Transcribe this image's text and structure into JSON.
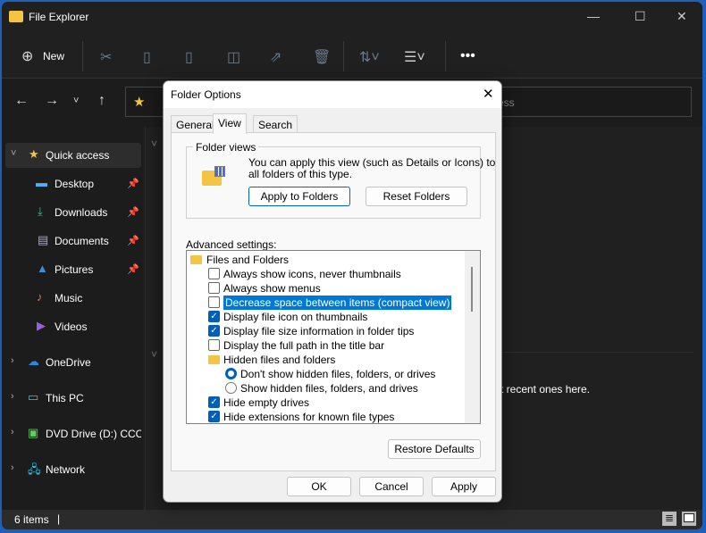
{
  "window": {
    "title": "File Explorer",
    "controls": [
      "minimize",
      "maximize",
      "close"
    ]
  },
  "toolbar": {
    "new_label": "New",
    "icons": [
      "cut-icon",
      "copy-icon",
      "paste-icon",
      "rename-icon",
      "share-icon",
      "delete-icon",
      "sort-icon",
      "view-icon",
      "more-icon"
    ]
  },
  "address": {
    "search_fragment": "ess"
  },
  "sidebar": {
    "quick_access": "Quick access",
    "pinned": [
      {
        "label": "Desktop"
      },
      {
        "label": "Downloads"
      },
      {
        "label": "Documents"
      },
      {
        "label": "Pictures"
      },
      {
        "label": "Music"
      },
      {
        "label": "Videos"
      }
    ],
    "roots": [
      {
        "label": "OneDrive"
      },
      {
        "label": "This PC"
      },
      {
        "label": "DVD Drive (D:) CCCC"
      },
      {
        "label": "Network"
      }
    ]
  },
  "content": {
    "fragment": "t recent ones here."
  },
  "status": {
    "items": "6 items"
  },
  "dialog": {
    "title": "Folder Options",
    "tabs": [
      "General",
      "View",
      "Search"
    ],
    "active_tab": "View",
    "folder_views": {
      "legend": "Folder views",
      "text1": "You can apply this view (such as Details or Icons) to",
      "text2": "all folders of this type.",
      "apply": "Apply to Folders",
      "reset": "Reset Folders"
    },
    "advanced_label": "Advanced settings:",
    "items": [
      {
        "type": "folder",
        "label": "Files and Folders"
      },
      {
        "type": "check",
        "label": "Always show icons, never thumbnails",
        "checked": false
      },
      {
        "type": "check",
        "label": "Always show menus",
        "checked": false
      },
      {
        "type": "check",
        "label": "Decrease space between items (compact view)",
        "checked": false,
        "selected": true
      },
      {
        "type": "check",
        "label": "Display file icon on thumbnails",
        "checked": true
      },
      {
        "type": "check",
        "label": "Display file size information in folder tips",
        "checked": true
      },
      {
        "type": "check",
        "label": "Display the full path in the title bar",
        "checked": false
      },
      {
        "type": "subfolder",
        "label": "Hidden files and folders"
      },
      {
        "type": "radio",
        "label": "Don't show hidden files, folders, or drives",
        "checked": true
      },
      {
        "type": "radio",
        "label": "Show hidden files, folders, and drives",
        "checked": false
      },
      {
        "type": "check",
        "label": "Hide empty drives",
        "checked": true
      },
      {
        "type": "check",
        "label": "Hide extensions for known file types",
        "checked": true
      }
    ],
    "restore": "Restore Defaults",
    "ok": "OK",
    "cancel": "Cancel",
    "apply": "Apply"
  }
}
